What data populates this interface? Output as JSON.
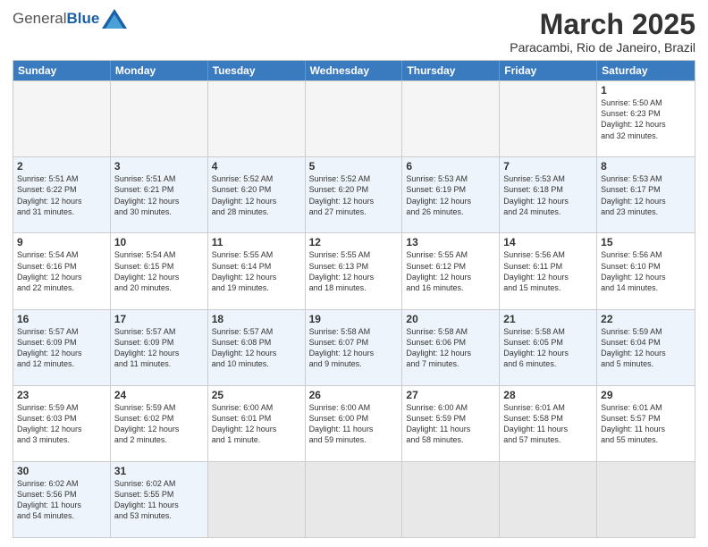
{
  "header": {
    "logo_general": "General",
    "logo_blue": "Blue",
    "month_title": "March 2025",
    "location": "Paracambi, Rio de Janeiro, Brazil"
  },
  "days_of_week": [
    "Sunday",
    "Monday",
    "Tuesday",
    "Wednesday",
    "Thursday",
    "Friday",
    "Saturday"
  ],
  "weeks": [
    {
      "alt": false,
      "cells": [
        {
          "day": "",
          "empty": true,
          "info": ""
        },
        {
          "day": "",
          "empty": true,
          "info": ""
        },
        {
          "day": "",
          "empty": true,
          "info": ""
        },
        {
          "day": "",
          "empty": true,
          "info": ""
        },
        {
          "day": "",
          "empty": true,
          "info": ""
        },
        {
          "day": "",
          "empty": true,
          "info": ""
        },
        {
          "day": "1",
          "empty": false,
          "info": "Sunrise: 5:50 AM\nSunset: 6:23 PM\nDaylight: 12 hours\nand 32 minutes."
        }
      ]
    },
    {
      "alt": true,
      "cells": [
        {
          "day": "2",
          "empty": false,
          "info": "Sunrise: 5:51 AM\nSunset: 6:22 PM\nDaylight: 12 hours\nand 31 minutes."
        },
        {
          "day": "3",
          "empty": false,
          "info": "Sunrise: 5:51 AM\nSunset: 6:21 PM\nDaylight: 12 hours\nand 30 minutes."
        },
        {
          "day": "4",
          "empty": false,
          "info": "Sunrise: 5:52 AM\nSunset: 6:20 PM\nDaylight: 12 hours\nand 28 minutes."
        },
        {
          "day": "5",
          "empty": false,
          "info": "Sunrise: 5:52 AM\nSunset: 6:20 PM\nDaylight: 12 hours\nand 27 minutes."
        },
        {
          "day": "6",
          "empty": false,
          "info": "Sunrise: 5:53 AM\nSunset: 6:19 PM\nDaylight: 12 hours\nand 26 minutes."
        },
        {
          "day": "7",
          "empty": false,
          "info": "Sunrise: 5:53 AM\nSunset: 6:18 PM\nDaylight: 12 hours\nand 24 minutes."
        },
        {
          "day": "8",
          "empty": false,
          "info": "Sunrise: 5:53 AM\nSunset: 6:17 PM\nDaylight: 12 hours\nand 23 minutes."
        }
      ]
    },
    {
      "alt": false,
      "cells": [
        {
          "day": "9",
          "empty": false,
          "info": "Sunrise: 5:54 AM\nSunset: 6:16 PM\nDaylight: 12 hours\nand 22 minutes."
        },
        {
          "day": "10",
          "empty": false,
          "info": "Sunrise: 5:54 AM\nSunset: 6:15 PM\nDaylight: 12 hours\nand 20 minutes."
        },
        {
          "day": "11",
          "empty": false,
          "info": "Sunrise: 5:55 AM\nSunset: 6:14 PM\nDaylight: 12 hours\nand 19 minutes."
        },
        {
          "day": "12",
          "empty": false,
          "info": "Sunrise: 5:55 AM\nSunset: 6:13 PM\nDaylight: 12 hours\nand 18 minutes."
        },
        {
          "day": "13",
          "empty": false,
          "info": "Sunrise: 5:55 AM\nSunset: 6:12 PM\nDaylight: 12 hours\nand 16 minutes."
        },
        {
          "day": "14",
          "empty": false,
          "info": "Sunrise: 5:56 AM\nSunset: 6:11 PM\nDaylight: 12 hours\nand 15 minutes."
        },
        {
          "day": "15",
          "empty": false,
          "info": "Sunrise: 5:56 AM\nSunset: 6:10 PM\nDaylight: 12 hours\nand 14 minutes."
        }
      ]
    },
    {
      "alt": true,
      "cells": [
        {
          "day": "16",
          "empty": false,
          "info": "Sunrise: 5:57 AM\nSunset: 6:09 PM\nDaylight: 12 hours\nand 12 minutes."
        },
        {
          "day": "17",
          "empty": false,
          "info": "Sunrise: 5:57 AM\nSunset: 6:09 PM\nDaylight: 12 hours\nand 11 minutes."
        },
        {
          "day": "18",
          "empty": false,
          "info": "Sunrise: 5:57 AM\nSunset: 6:08 PM\nDaylight: 12 hours\nand 10 minutes."
        },
        {
          "day": "19",
          "empty": false,
          "info": "Sunrise: 5:58 AM\nSunset: 6:07 PM\nDaylight: 12 hours\nand 9 minutes."
        },
        {
          "day": "20",
          "empty": false,
          "info": "Sunrise: 5:58 AM\nSunset: 6:06 PM\nDaylight: 12 hours\nand 7 minutes."
        },
        {
          "day": "21",
          "empty": false,
          "info": "Sunrise: 5:58 AM\nSunset: 6:05 PM\nDaylight: 12 hours\nand 6 minutes."
        },
        {
          "day": "22",
          "empty": false,
          "info": "Sunrise: 5:59 AM\nSunset: 6:04 PM\nDaylight: 12 hours\nand 5 minutes."
        }
      ]
    },
    {
      "alt": false,
      "cells": [
        {
          "day": "23",
          "empty": false,
          "info": "Sunrise: 5:59 AM\nSunset: 6:03 PM\nDaylight: 12 hours\nand 3 minutes."
        },
        {
          "day": "24",
          "empty": false,
          "info": "Sunrise: 5:59 AM\nSunset: 6:02 PM\nDaylight: 12 hours\nand 2 minutes."
        },
        {
          "day": "25",
          "empty": false,
          "info": "Sunrise: 6:00 AM\nSunset: 6:01 PM\nDaylight: 12 hours\nand 1 minute."
        },
        {
          "day": "26",
          "empty": false,
          "info": "Sunrise: 6:00 AM\nSunset: 6:00 PM\nDaylight: 11 hours\nand 59 minutes."
        },
        {
          "day": "27",
          "empty": false,
          "info": "Sunrise: 6:00 AM\nSunset: 5:59 PM\nDaylight: 11 hours\nand 58 minutes."
        },
        {
          "day": "28",
          "empty": false,
          "info": "Sunrise: 6:01 AM\nSunset: 5:58 PM\nDaylight: 11 hours\nand 57 minutes."
        },
        {
          "day": "29",
          "empty": false,
          "info": "Sunrise: 6:01 AM\nSunset: 5:57 PM\nDaylight: 11 hours\nand 55 minutes."
        }
      ]
    },
    {
      "alt": true,
      "cells": [
        {
          "day": "30",
          "empty": false,
          "info": "Sunrise: 6:02 AM\nSunset: 5:56 PM\nDaylight: 11 hours\nand 54 minutes."
        },
        {
          "day": "31",
          "empty": false,
          "info": "Sunrise: 6:02 AM\nSunset: 5:55 PM\nDaylight: 11 hours\nand 53 minutes."
        },
        {
          "day": "",
          "empty": true,
          "info": ""
        },
        {
          "day": "",
          "empty": true,
          "info": ""
        },
        {
          "day": "",
          "empty": true,
          "info": ""
        },
        {
          "day": "",
          "empty": true,
          "info": ""
        },
        {
          "day": "",
          "empty": true,
          "info": ""
        }
      ]
    }
  ]
}
